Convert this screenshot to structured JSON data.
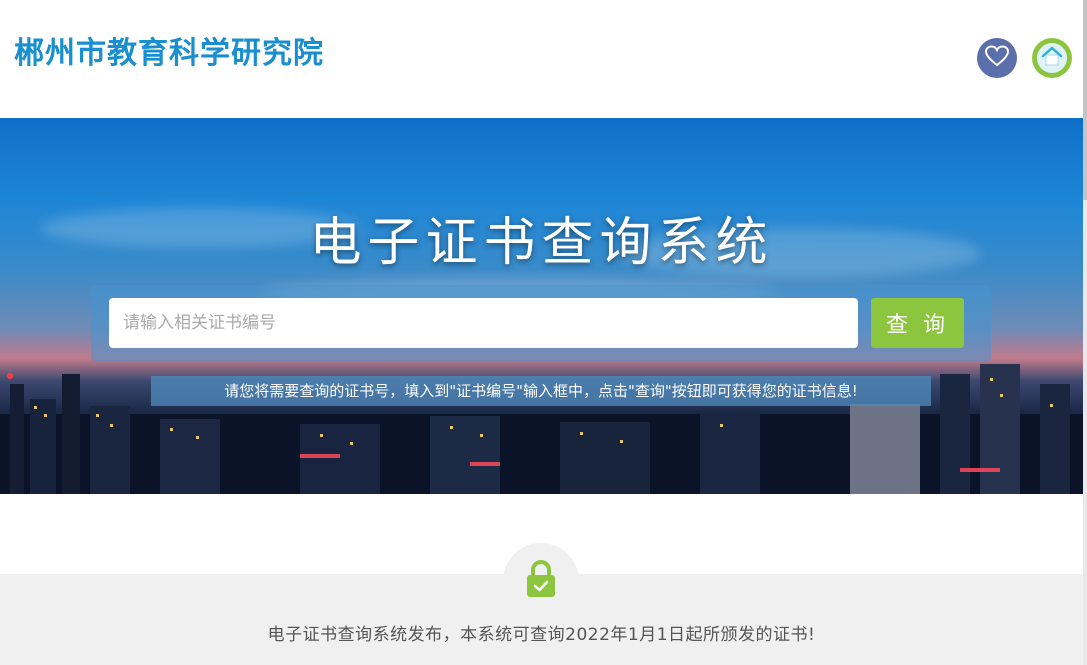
{
  "header": {
    "site_title": "郴州市教育科学研究院",
    "favorite_icon": "heart-icon",
    "home_icon": "home-icon",
    "colors": {
      "title": "#1a8fd0",
      "favorite_bg": "#5b6faa",
      "home_bg": "#8bc540"
    }
  },
  "banner": {
    "title": "电子证书查询系统",
    "search": {
      "placeholder": "请输入相关证书编号",
      "value": "",
      "button_label": "查 询"
    },
    "hint": "请您将需要查询的证书号，填入到\"证书编号\"输入框中，点击\"查询\"按钮即可获得您的证书信息!",
    "colors": {
      "button": "#8cc63f"
    }
  },
  "notice": {
    "icon": "lock-icon",
    "text": "电子证书查询系统发布，本系统可查询2022年1月1日起所颁发的证书!"
  }
}
